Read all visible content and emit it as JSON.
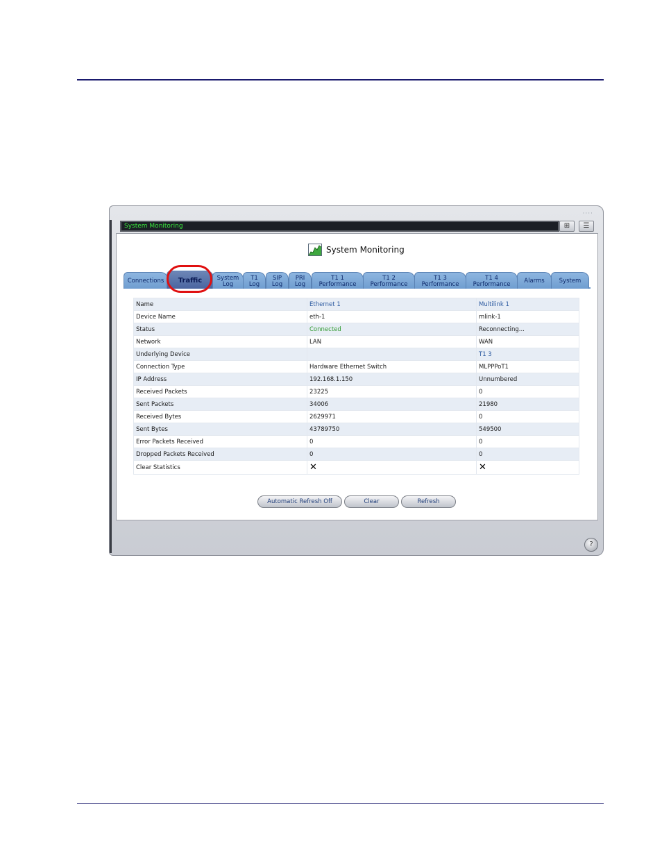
{
  "window": {
    "title": "System Monitoring",
    "dots": "····",
    "buttons": [
      {
        "icon": "layout-icon",
        "glyph": "⊞"
      },
      {
        "icon": "menu-icon",
        "glyph": "☰"
      }
    ],
    "help_label": "?"
  },
  "page": {
    "heading": "System Monitoring",
    "heading_icon": "traffic-graph-icon"
  },
  "tabs": [
    {
      "l1": "Connections",
      "l2": ""
    },
    {
      "l1": "Traffic",
      "l2": ""
    },
    {
      "l1": "System",
      "l2": "Log"
    },
    {
      "l1": "T1",
      "l2": "Log"
    },
    {
      "l1": "SIP",
      "l2": "Log"
    },
    {
      "l1": "PRI",
      "l2": "Log"
    },
    {
      "l1": "T1 1",
      "l2": "Performance"
    },
    {
      "l1": "T1 2",
      "l2": "Performance"
    },
    {
      "l1": "T1 3",
      "l2": "Performance"
    },
    {
      "l1": "T1 4",
      "l2": "Performance"
    },
    {
      "l1": "Alarms",
      "l2": ""
    },
    {
      "l1": "System",
      "l2": ""
    }
  ],
  "active_tab": "Traffic",
  "table": {
    "rows": [
      [
        "Name",
        "Ethernet 1",
        "Multilink 1"
      ],
      [
        "Device Name",
        "eth-1",
        "mlink-1"
      ],
      [
        "Status",
        "Connected",
        "Reconnecting..."
      ],
      [
        "Network",
        "LAN",
        "WAN"
      ],
      [
        "Underlying Device",
        "",
        "T1 3"
      ],
      [
        "Connection Type",
        "Hardware Ethernet Switch",
        "MLPPPoT1"
      ],
      [
        "IP Address",
        "192.168.1.150",
        "Unnumbered"
      ],
      [
        "Received Packets",
        "23225",
        "0"
      ],
      [
        "Sent Packets",
        "34006",
        "21980"
      ],
      [
        "Received Bytes",
        "2629971",
        "0"
      ],
      [
        "Sent Bytes",
        "43789750",
        "549500"
      ],
      [
        "Error Packets Received",
        "0",
        "0"
      ],
      [
        "Dropped Packets Received",
        "0",
        "0"
      ],
      [
        "Clear Statistics",
        "✕",
        "✕"
      ]
    ]
  },
  "buttons": {
    "auto_refresh": "Automatic Refresh Off",
    "clear": "Clear",
    "refresh": "Refresh"
  }
}
